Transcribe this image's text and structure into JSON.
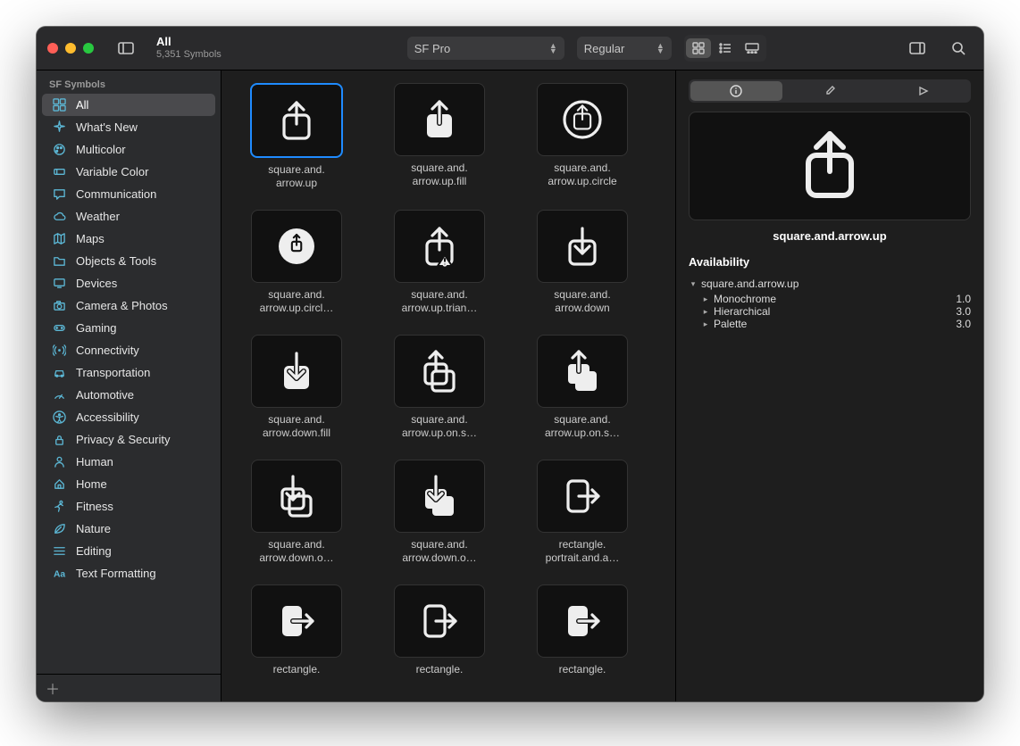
{
  "window": {
    "title": "All",
    "subtitle": "5,351 Symbols"
  },
  "toolbar": {
    "font_select": "SF Pro",
    "weight_select": "Regular"
  },
  "sidebar": {
    "header": "SF Symbols",
    "items": [
      {
        "label": "All",
        "icon": "grid",
        "selected": true
      },
      {
        "label": "What's New",
        "icon": "sparkle"
      },
      {
        "label": "Multicolor",
        "icon": "palette"
      },
      {
        "label": "Variable Color",
        "icon": "slider"
      },
      {
        "label": "Communication",
        "icon": "bubble"
      },
      {
        "label": "Weather",
        "icon": "cloud"
      },
      {
        "label": "Maps",
        "icon": "map"
      },
      {
        "label": "Objects & Tools",
        "icon": "folder"
      },
      {
        "label": "Devices",
        "icon": "display"
      },
      {
        "label": "Camera & Photos",
        "icon": "camera"
      },
      {
        "label": "Gaming",
        "icon": "gamepad"
      },
      {
        "label": "Connectivity",
        "icon": "antenna"
      },
      {
        "label": "Transportation",
        "icon": "car"
      },
      {
        "label": "Automotive",
        "icon": "gauge"
      },
      {
        "label": "Accessibility",
        "icon": "accessibility"
      },
      {
        "label": "Privacy & Security",
        "icon": "lock"
      },
      {
        "label": "Human",
        "icon": "person"
      },
      {
        "label": "Home",
        "icon": "house"
      },
      {
        "label": "Fitness",
        "icon": "runner"
      },
      {
        "label": "Nature",
        "icon": "leaf"
      },
      {
        "label": "Editing",
        "icon": "lines"
      },
      {
        "label": "Text Formatting",
        "icon": "text"
      }
    ]
  },
  "grid": {
    "items": [
      {
        "name": "square.and.arrow.up",
        "display": "square.and.\narrow.up",
        "icon": "share-up",
        "selected": true
      },
      {
        "name": "square.and.arrow.up.fill",
        "display": "square.and.\narrow.up.fill",
        "icon": "share-up-fill"
      },
      {
        "name": "square.and.arrow.up.circle",
        "display": "square.and.\narrow.up.circle",
        "icon": "share-up-circle"
      },
      {
        "name": "square.and.arrow.up.circle.fill",
        "display": "square.and.\narrow.up.circl…",
        "icon": "share-up-circle-fill"
      },
      {
        "name": "square.and.arrow.up.trianglebadge.exclamationmark",
        "display": "square.and.\narrow.up.trian…",
        "icon": "share-up-warn"
      },
      {
        "name": "square.and.arrow.down",
        "display": "square.and.\narrow.down",
        "icon": "share-down"
      },
      {
        "name": "square.and.arrow.down.fill",
        "display": "square.and.\narrow.down.fill",
        "icon": "share-down-fill"
      },
      {
        "name": "square.and.arrow.up.on.square",
        "display": "square.and.\narrow.up.on.s…",
        "icon": "share-up-stack"
      },
      {
        "name": "square.and.arrow.up.on.square.fill",
        "display": "square.and.\narrow.up.on.s…",
        "icon": "share-up-stack-fill"
      },
      {
        "name": "square.and.arrow.down.on.square",
        "display": "square.and.\narrow.down.o…",
        "icon": "share-down-stack"
      },
      {
        "name": "square.and.arrow.down.on.square.fill",
        "display": "square.and.\narrow.down.o…",
        "icon": "share-down-stack-fill"
      },
      {
        "name": "rectangle.portrait.and.arrow.right",
        "display": "rectangle.\nportrait.and.a…",
        "icon": "rect-port-right"
      },
      {
        "name": "rectangle.portrait.and.arrow.right.fill",
        "display": "rectangle.",
        "icon": "rect-port-right-fill"
      },
      {
        "name": "rectangle.portrait.and.arrow.forward",
        "display": "rectangle.",
        "icon": "rect-port-right"
      },
      {
        "name": "rectangle.portrait.and.arrow.forward.fill",
        "display": "rectangle.",
        "icon": "rect-port-right-fill"
      }
    ]
  },
  "inspector": {
    "preview_name": "square.and.arrow.up",
    "availability_header": "Availability",
    "tree_root": "square.and.arrow.up",
    "variants": [
      {
        "name": "Monochrome",
        "version": "1.0"
      },
      {
        "name": "Hierarchical",
        "version": "3.0"
      },
      {
        "name": "Palette",
        "version": "3.0"
      }
    ]
  }
}
